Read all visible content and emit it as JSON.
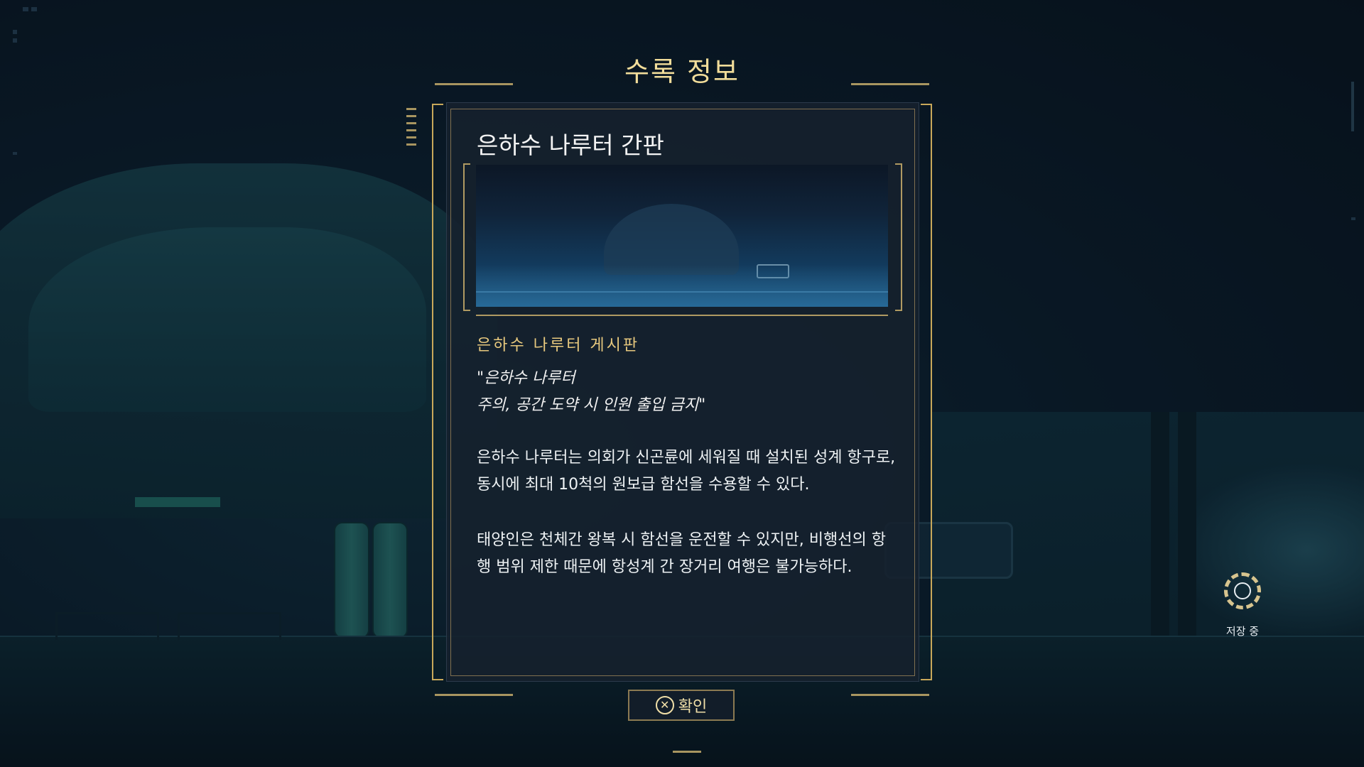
{
  "dialog": {
    "title": "수록 정보",
    "item_name": "은하수 나루터 간판",
    "subtitle": "은하수 나루터 게시판",
    "quote": "\"은하수 나루터\n주의, 공간 도약 시 인원 출입 금지\"",
    "body_paragraph_1": "은하수 나루터는 의회가 신곤륜에 세워질 때 설치된 성계 항구로, 동시에 최대 10척의 원보급 함선을 수용할 수 있다.",
    "body_paragraph_2": "태양인은 천체간 왕복 시 함선을 운전할 수 있지만, 비행선의 항행 범위 제한 때문에 항성계 간 장거리 여행은 불가능하다.",
    "confirm_button": {
      "icon": "cross-button-icon",
      "icon_glyph": "✕",
      "label": "확인"
    }
  },
  "status": {
    "saving_icon": "saving-spinner-icon",
    "saving_label": "저장 중"
  },
  "colors": {
    "accent_gold": "#e8c97e",
    "title_gold": "#f2dd9a",
    "frame_gold": "#c8a85a",
    "panel_bg": "#16212e",
    "background": "#0c1f2e"
  }
}
